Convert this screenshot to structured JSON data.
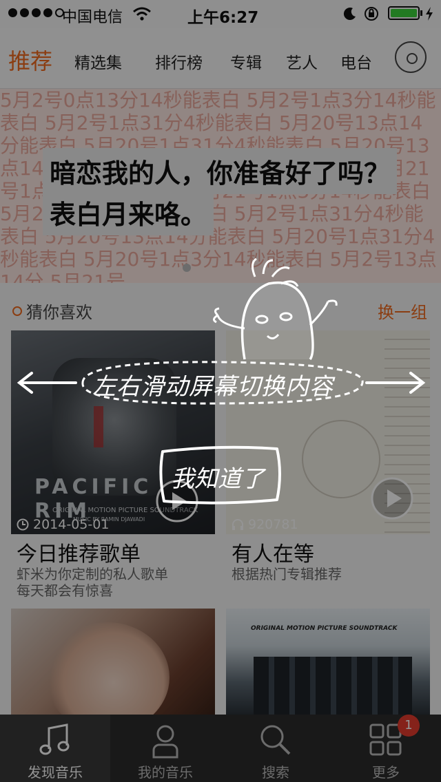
{
  "status_bar": {
    "carrier": "中国电信",
    "time": "上午6:27"
  },
  "top_nav": {
    "tabs": [
      {
        "label": "推荐",
        "active": true
      },
      {
        "label": "精选集",
        "active": false
      },
      {
        "label": "排行榜",
        "active": false
      },
      {
        "label": "专辑",
        "active": false
      },
      {
        "label": "艺人",
        "active": false
      },
      {
        "label": "电台",
        "active": false
      }
    ],
    "disc_icon": "vinyl-disc-icon"
  },
  "banner": {
    "line1": "暗恋我的人，你准备好了吗？",
    "line2": "表白月来咯。",
    "background_text": "5月2号0点13分14秒能表白 5月2号1点3分14秒能表白 5月2号1点31分4秒能表白 5月20号13点14分能表白 5月20号1点31分4秒能表白 5月20号13点14分能表白 5月20号1点3分14秒能表白 5月21号1点31分4秒能表白 5月21号1点3分14秒能表白 5月2号1点3分14秒能表白 5月2号1点31分4秒能表白 5月20号13点14分能表白 5月20号1点31分4秒能表白 5月20号1点3分14秒能表白 5月2号13点14分 5月21号"
  },
  "section": {
    "title": "猜你喜欢",
    "refresh_label": "换一组"
  },
  "cards": [
    {
      "title": "今日推荐歌单",
      "subtitle_line1": "虾米为你定制的私人歌单",
      "subtitle_line2": "每天都会有惊喜",
      "meta": "2014-05-01",
      "meta_icon": "clock-icon",
      "image_text_line1": "PACIFIC RIM",
      "image_text_line2": "ORIGINAL MOTION PICTURE SOUNDTRACK",
      "image_text_line3": "MUSIC BY RAMIN DJAWADI"
    },
    {
      "title": "有人在等",
      "subtitle_line1": "根据热门专辑推荐",
      "meta": "920781",
      "meta_icon": "headphones-icon"
    },
    {
      "image_label": "portrait-photo"
    },
    {
      "image_text": "ORIGINAL MOTION PICTURE SOUNDTRACK"
    }
  ],
  "overlay": {
    "swipe_hint": "左右滑动屏幕切换内容",
    "dismiss_label": "我知道了"
  },
  "bottom_bar": {
    "items": [
      {
        "label": "发现音乐",
        "icon": "music-note-icon",
        "active": true
      },
      {
        "label": "我的音乐",
        "icon": "user-icon",
        "active": false
      },
      {
        "label": "搜索",
        "icon": "search-icon",
        "active": false
      },
      {
        "label": "更多",
        "icon": "grid-icon",
        "active": false
      }
    ],
    "badge": "1"
  },
  "colors": {
    "accent": "#ef6a1e",
    "badge": "#e63c2e",
    "tabbar": "#2b2b2b"
  }
}
